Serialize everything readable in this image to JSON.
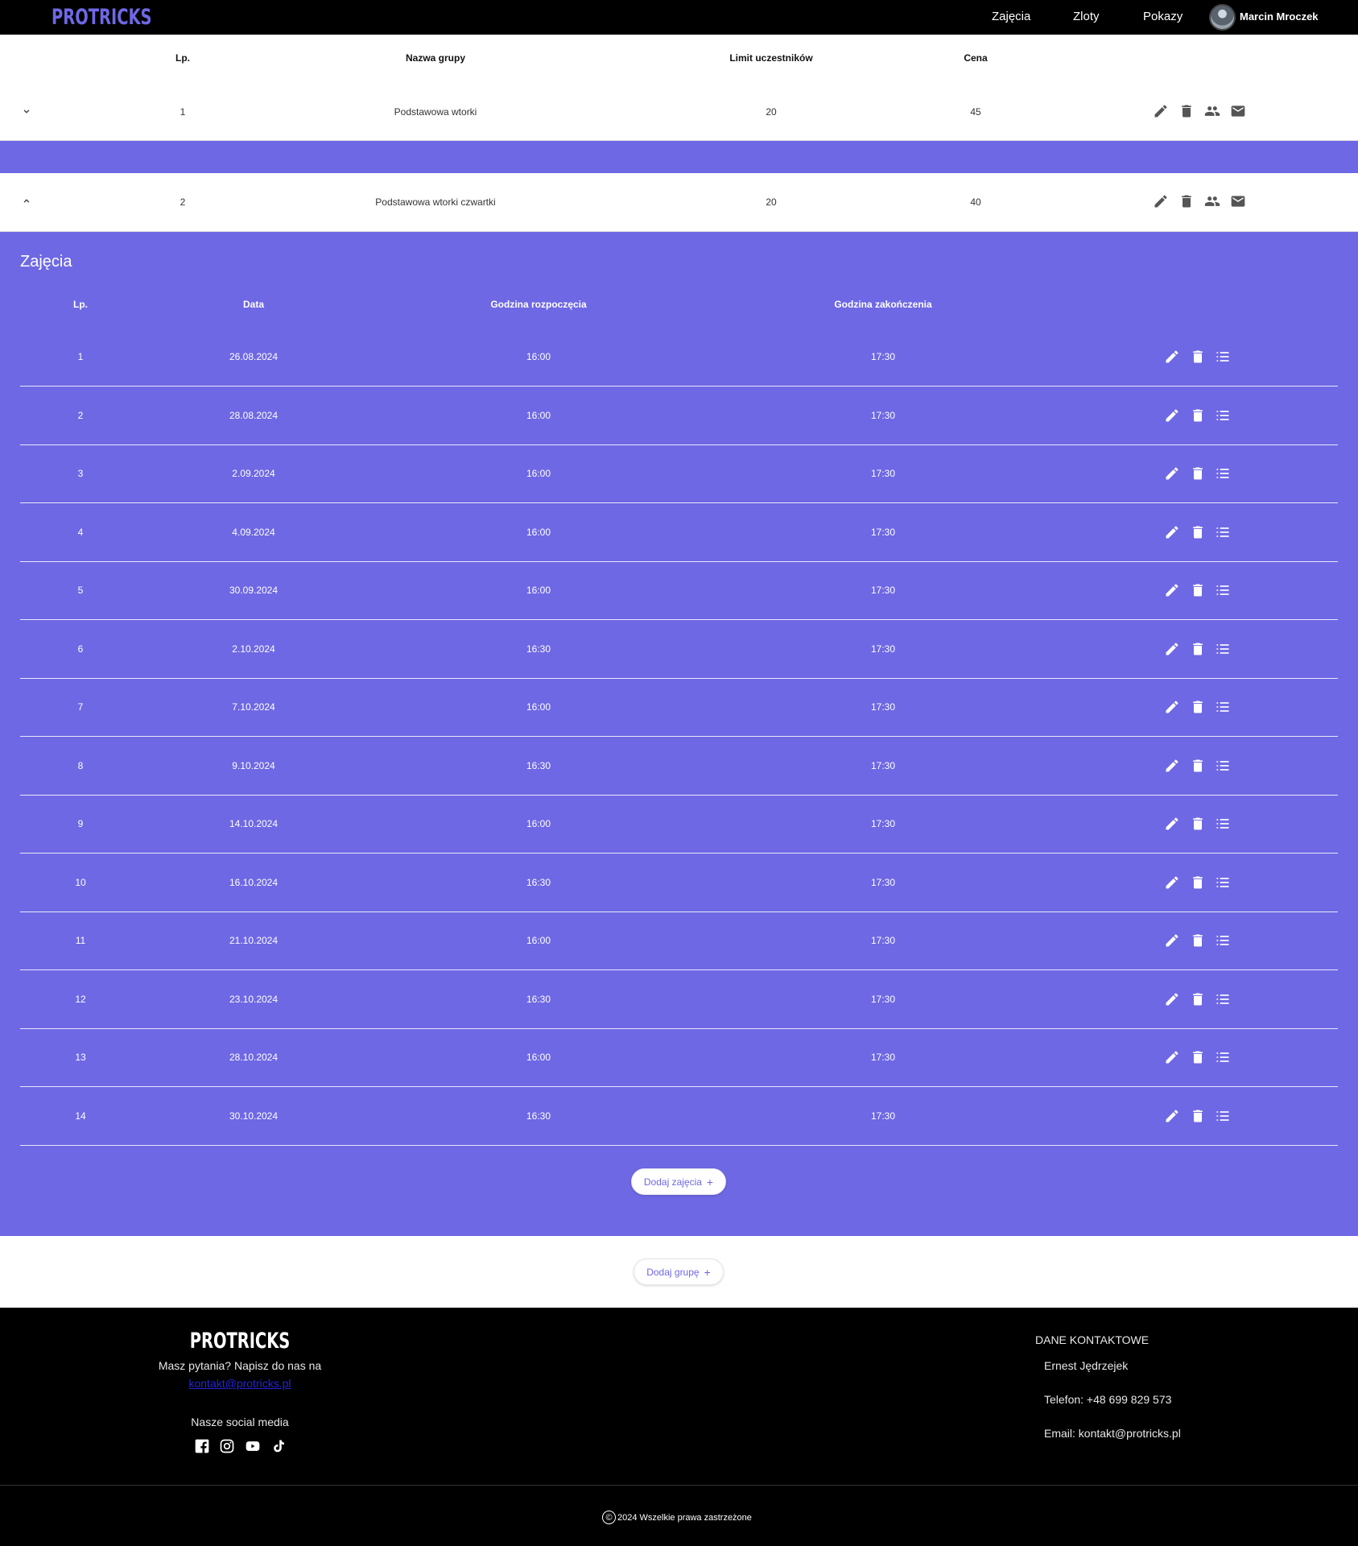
{
  "header": {
    "logo": "PROTRICKS",
    "nav": [
      "Zajęcia",
      "Zloty",
      "Pokazy"
    ],
    "user_name": "Marcin Mroczek"
  },
  "groups_table": {
    "columns": [
      "Lp.",
      "Nazwa grupy",
      "Limit uczestników",
      "Cena"
    ],
    "rows": [
      {
        "lp": "1",
        "name": "Podstawowa wtorki",
        "limit": "20",
        "price": "45",
        "expanded": false
      },
      {
        "lp": "2",
        "name": "Podstawowa wtorki czwartki",
        "limit": "20",
        "price": "40",
        "expanded": true
      }
    ],
    "row_actions": [
      "edit-icon",
      "delete-icon",
      "people-icon",
      "mail-icon"
    ]
  },
  "sessions_panel": {
    "title": "Zajęcia",
    "columns": [
      "Lp.",
      "Data",
      "Godzina rozpoczęcia",
      "Godzina zakończenia"
    ],
    "rows": [
      {
        "lp": "1",
        "date": "26.08.2024",
        "start": "16:00",
        "end": "17:30"
      },
      {
        "lp": "2",
        "date": "28.08.2024",
        "start": "16:00",
        "end": "17:30"
      },
      {
        "lp": "3",
        "date": "2.09.2024",
        "start": "16:00",
        "end": "17:30"
      },
      {
        "lp": "4",
        "date": "4.09.2024",
        "start": "16:00",
        "end": "17:30"
      },
      {
        "lp": "5",
        "date": "30.09.2024",
        "start": "16:00",
        "end": "17:30"
      },
      {
        "lp": "6",
        "date": "2.10.2024",
        "start": "16:30",
        "end": "17:30"
      },
      {
        "lp": "7",
        "date": "7.10.2024",
        "start": "16:00",
        "end": "17:30"
      },
      {
        "lp": "8",
        "date": "9.10.2024",
        "start": "16:30",
        "end": "17:30"
      },
      {
        "lp": "9",
        "date": "14.10.2024",
        "start": "16:00",
        "end": "17:30"
      },
      {
        "lp": "10",
        "date": "16.10.2024",
        "start": "16:30",
        "end": "17:30"
      },
      {
        "lp": "11",
        "date": "21.10.2024",
        "start": "16:00",
        "end": "17:30"
      },
      {
        "lp": "12",
        "date": "23.10.2024",
        "start": "16:30",
        "end": "17:30"
      },
      {
        "lp": "13",
        "date": "28.10.2024",
        "start": "16:00",
        "end": "17:30"
      },
      {
        "lp": "14",
        "date": "30.10.2024",
        "start": "16:30",
        "end": "17:30"
      }
    ],
    "row_actions": [
      "edit-icon",
      "delete-icon",
      "list-icon"
    ],
    "add_button": "Dodaj zajęcia",
    "add_icon": "+"
  },
  "add_group_button": "Dodaj grupę",
  "add_group_icon": "+",
  "footer": {
    "logo": "PROTRICKS",
    "question": "Masz pytania? Napisz do nas na",
    "email_link": "kontakt@protricks.pl",
    "social_title": "Nasze social media",
    "social_icons": [
      "facebook-icon",
      "instagram-icon",
      "youtube-icon",
      "tiktok-icon"
    ],
    "contact_title": "DANE KONTAKTOWE",
    "contact_name": "Ernest Jędrzejek",
    "contact_phone": "Telefon: +48 699 829 573",
    "contact_email": "Email: kontakt@protricks.pl",
    "copyright_symbol": "©",
    "copyright": "2024 Wszelkie prawa zastrzeżone"
  },
  "colors": {
    "accent": "#6e68e4",
    "topbar": "#000000",
    "footer": "#000000"
  }
}
